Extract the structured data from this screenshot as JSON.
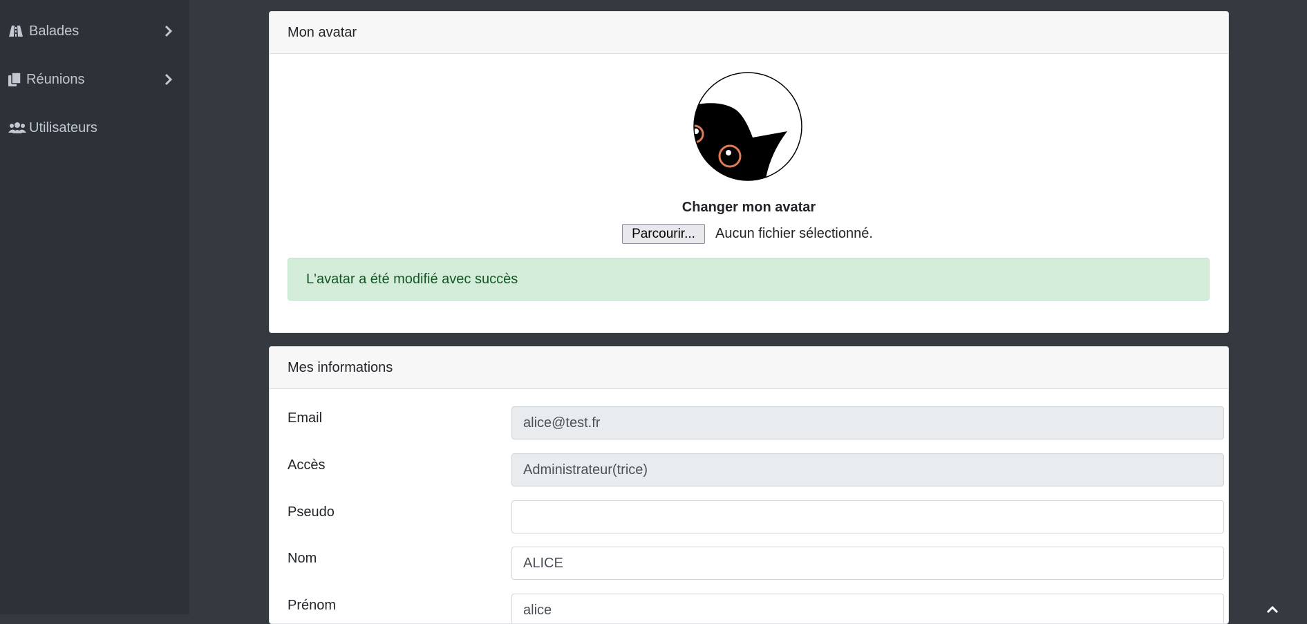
{
  "sidebar": {
    "items": [
      {
        "label": "Balades",
        "icon": "road-icon",
        "has_submenu": true
      },
      {
        "label": "Réunions",
        "icon": "documents-icon",
        "has_submenu": true
      },
      {
        "label": "Utilisateurs",
        "icon": "users-icon",
        "has_submenu": false
      }
    ]
  },
  "avatar_card": {
    "title": "Mon avatar",
    "change_title": "Changer mon avatar",
    "browse_label": "Parcourir...",
    "file_status": "Aucun fichier sélectionné.",
    "success_message": "L'avatar a été modifié avec succès"
  },
  "info_card": {
    "title": "Mes informations",
    "fields": [
      {
        "label": "Email",
        "value": "alice@test.fr",
        "readonly": true
      },
      {
        "label": "Accès",
        "value": "Administrateur(trice)",
        "readonly": true
      },
      {
        "label": "Pseudo",
        "value": "",
        "readonly": false
      },
      {
        "label": "Nom",
        "value": "ALICE",
        "readonly": false
      },
      {
        "label": "Prénom",
        "value": "alice",
        "readonly": false
      }
    ]
  },
  "colors": {
    "sidebar_bg": "#2d3238",
    "content_bg": "#343a40",
    "success_bg": "#d4edda",
    "success_text": "#155724"
  }
}
